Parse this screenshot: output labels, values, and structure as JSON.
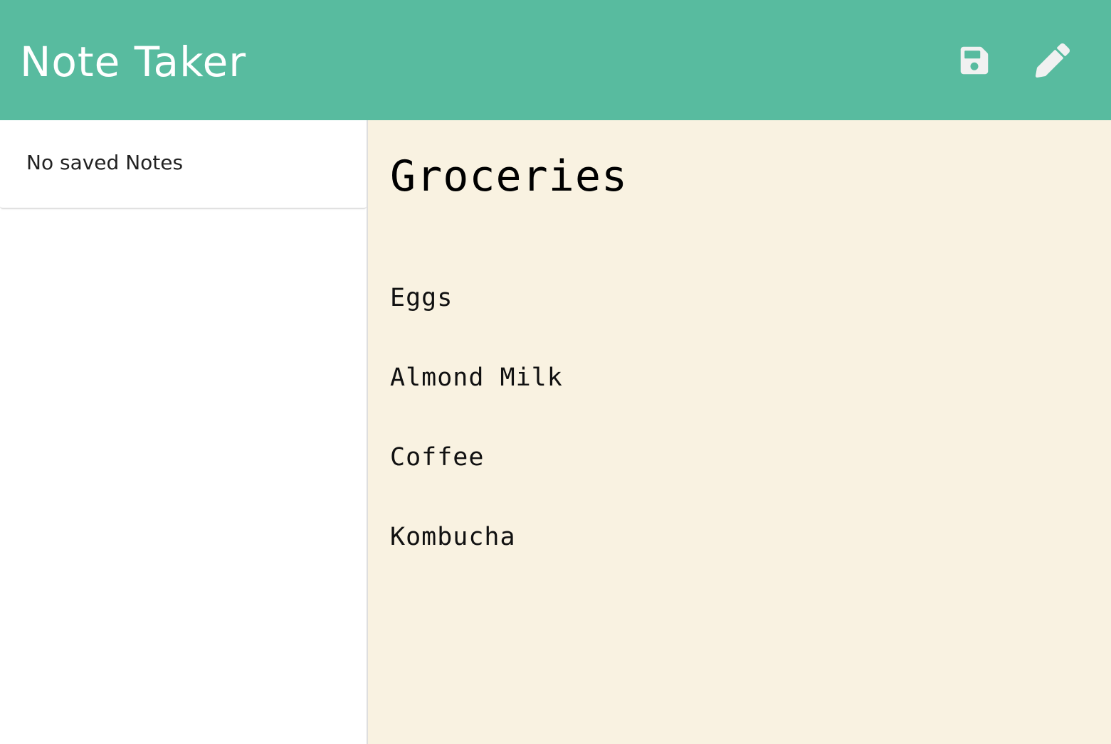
{
  "navbar": {
    "brand": "Note Taker",
    "accent_color": "#58bb9f",
    "save_icon": "floppy-disk-icon",
    "new_note_icon": "pencil-icon"
  },
  "sidebar": {
    "empty_message": "No saved Notes"
  },
  "editor": {
    "background_color": "#f9f2e1",
    "title": "Groceries",
    "body_lines": [
      "Eggs",
      "Almond Milk",
      "Coffee",
      "Kombucha"
    ]
  }
}
